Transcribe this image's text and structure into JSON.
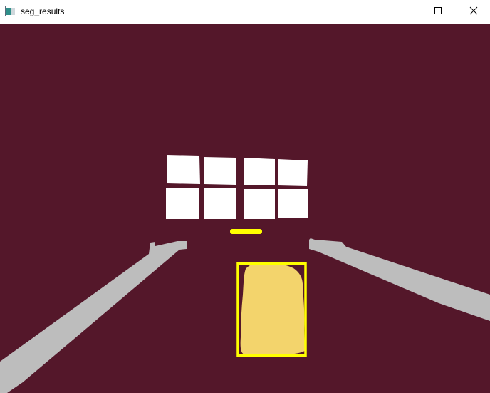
{
  "window": {
    "title": "seg_results"
  },
  "icons": {
    "app": "app-window-icon",
    "minimize": "minimize-icon",
    "maximize": "maximize-icon",
    "close": "close-icon"
  },
  "colors": {
    "background_class": "#54172A",
    "window_class": "#FFFFFF",
    "rail_class": "#BDBDBD",
    "detected_object_fill": "#F3D46C",
    "bounding_box": "#FFFF00"
  }
}
